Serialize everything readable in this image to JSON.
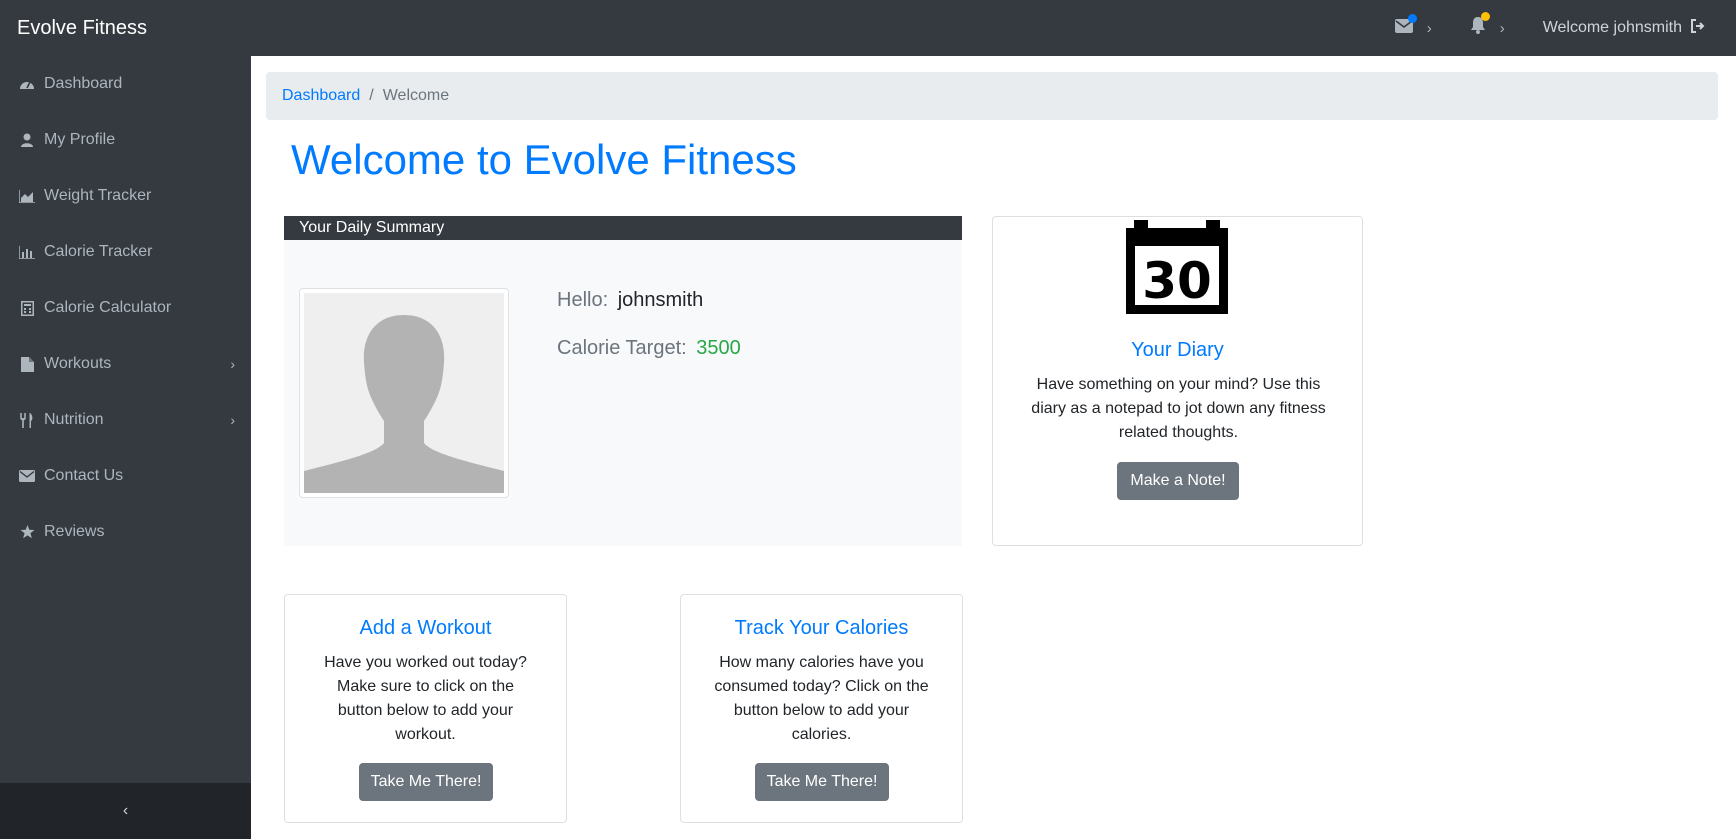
{
  "app": {
    "brand": "Evolve Fitness",
    "welcome_text": "Welcome johnsmith"
  },
  "colors": {
    "primary": "#007bff",
    "dark": "#343a40",
    "secondary": "#6c757d",
    "success": "#28a745",
    "mail_dot": "#007bff",
    "bell_dot": "#ffc107"
  },
  "sidebar": {
    "items": [
      {
        "label": "Dashboard",
        "icon": "dashboard-icon"
      },
      {
        "label": "My Profile",
        "icon": "user-icon"
      },
      {
        "label": "Weight Tracker",
        "icon": "area-chart-icon"
      },
      {
        "label": "Calorie Tracker",
        "icon": "bar-chart-icon"
      },
      {
        "label": "Calorie Calculator",
        "icon": "calculator-icon"
      },
      {
        "label": "Workouts",
        "icon": "file-icon"
      },
      {
        "label": "Nutrition",
        "icon": "cutlery-icon"
      },
      {
        "label": "Contact Us",
        "icon": "envelope-icon"
      },
      {
        "label": "Reviews",
        "icon": "star-icon"
      }
    ],
    "collapse_icon": "chevron-left-icon"
  },
  "breadcrumb": {
    "link": "Dashboard",
    "separator": "/",
    "current": "Welcome"
  },
  "main": {
    "title": "Welcome to Evolve Fitness",
    "summary": {
      "header": "Your Daily Summary",
      "hello_label": "Hello:",
      "username": "johnsmith",
      "target_label": "Calorie Target:",
      "target_value": "3500"
    },
    "diary": {
      "calendar_day": "30",
      "title": "Your Diary",
      "text": "Have something on your mind? Use this diary as a notepad to jot down any fitness related thoughts.",
      "button": "Make a Note!"
    },
    "workout": {
      "title": "Add a Workout",
      "text": "Have you worked out today? Make sure to click on the button below to add your workout.",
      "button": "Take Me There!"
    },
    "calories": {
      "title": "Track Your Calories",
      "text": "How many calories have you consumed today? Click on the button below to add your calories.",
      "button": "Take Me There!"
    }
  }
}
